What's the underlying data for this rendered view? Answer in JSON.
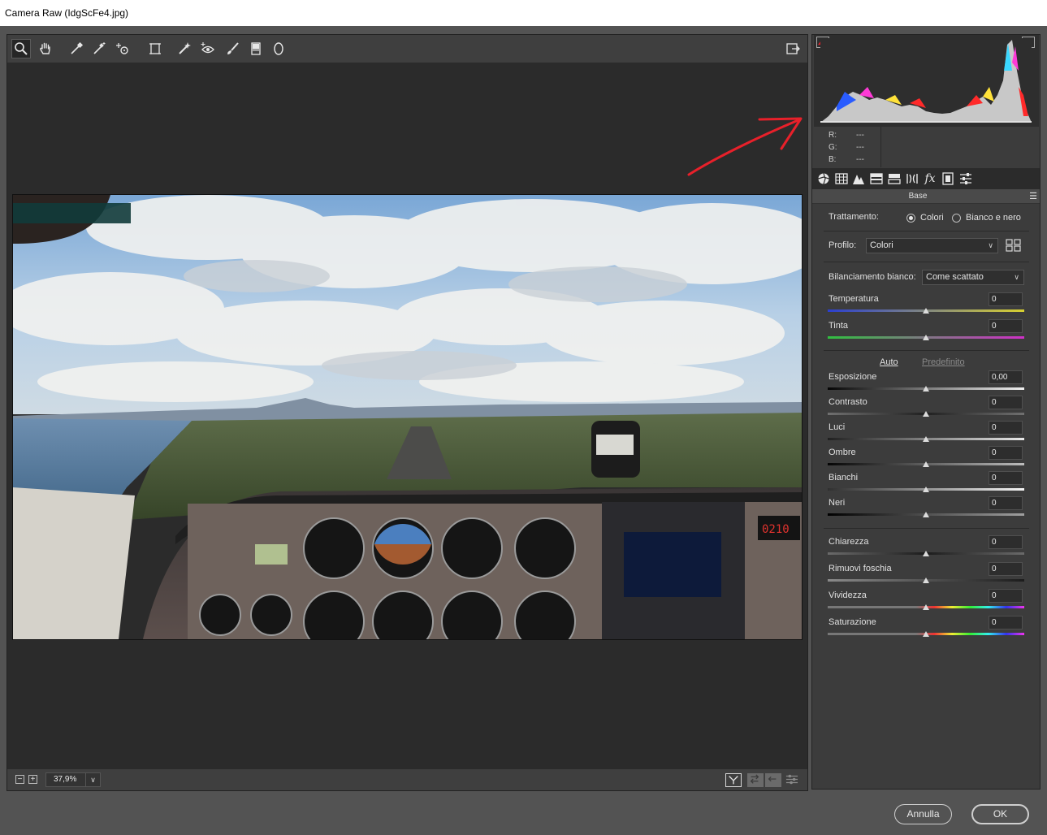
{
  "window": {
    "title": "Camera Raw (IdgScFe4.jpg)"
  },
  "toolbar": {
    "tools": [
      "zoom-tool",
      "hand-tool",
      "white-balance-tool",
      "color-sampler-tool",
      "targeted-adjustment-tool",
      "transform-tool",
      "spot-removal-tool",
      "red-eye-tool",
      "adjustment-brush-tool",
      "graduated-filter-tool",
      "radial-filter-tool"
    ],
    "active_tool": "zoom-tool"
  },
  "statusbar": {
    "zoom_value": "37,9%",
    "zoom_out": "−",
    "zoom_in": "+"
  },
  "histogram": {
    "r_label": "R:",
    "g_label": "G:",
    "b_label": "B:",
    "r_value": "---",
    "g_value": "---",
    "b_value": "---"
  },
  "panel": {
    "section_title": "Base",
    "treatment_label": "Trattamento:",
    "treatment_color": "Colori",
    "treatment_bw": "Bianco e nero",
    "profile_label": "Profilo:",
    "profile_value": "Colori",
    "wb_label": "Bilanciamento bianco:",
    "wb_value": "Come scattato",
    "auto_link": "Auto",
    "default_link": "Predefinito",
    "sliders": [
      {
        "label": "Temperatura",
        "value": "0"
      },
      {
        "label": "Tinta",
        "value": "0"
      },
      {
        "label": "Esposizione",
        "value": "0,00"
      },
      {
        "label": "Contrasto",
        "value": "0"
      },
      {
        "label": "Luci",
        "value": "0"
      },
      {
        "label": "Ombre",
        "value": "0"
      },
      {
        "label": "Bianchi",
        "value": "0"
      },
      {
        "label": "Neri",
        "value": "0"
      },
      {
        "label": "Chiarezza",
        "value": "0"
      },
      {
        "label": "Rimuovi foschia",
        "value": "0"
      },
      {
        "label": "Vividezza",
        "value": "0"
      },
      {
        "label": "Saturazione",
        "value": "0"
      }
    ]
  },
  "dialog": {
    "cancel_label": "Annulla",
    "ok_label": "OK"
  },
  "photo": {
    "gauge_readout": "0210"
  },
  "colors": {
    "accent_red": "#e8202a",
    "panel_bg": "#3c3c3c"
  }
}
